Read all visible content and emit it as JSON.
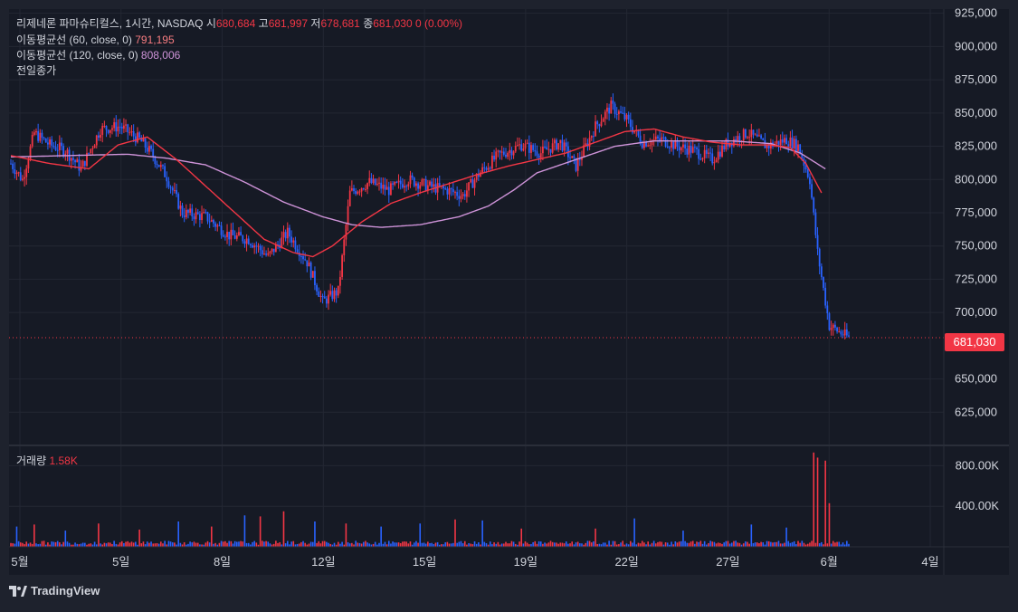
{
  "header": {
    "symbol": "리제네론 파마슈티컬스, 1시간, NASDAQ",
    "open_label": "시",
    "open": "680,684",
    "high_label": "고",
    "high": "681,997",
    "low_label": "저",
    "low": "678,681",
    "close_label": "종",
    "close": "681,030",
    "change": "0 (0.00%)",
    "ma60_label": "이동평균선 (60, close, 0)",
    "ma60_value": "791,195",
    "ma120_label": "이동평균선 (120, close, 0)",
    "ma120_value": "808,006",
    "prev_close_label": "전일종가"
  },
  "volume_panel": {
    "label": "거래량",
    "value": "1.58K"
  },
  "last_price_tag": "681,030",
  "branding": {
    "name": "TradingView"
  },
  "colors": {
    "background": "#1e222d",
    "up": "#f23645",
    "down": "#2962ff",
    "ma60": "#f23645",
    "ma120": "#ce93d8"
  },
  "chart_data": {
    "type": "candlestick",
    "x_tick_labels": [
      "5월",
      "5일",
      "8일",
      "12일",
      "15일",
      "19일",
      "22일",
      "27일",
      "6월",
      "4일"
    ],
    "price_axis_labels": [
      "925,000",
      "900,000",
      "875,000",
      "850,000",
      "825,000",
      "800,000",
      "775,000",
      "750,000",
      "725,000",
      "700,000",
      "650,000",
      "625,000"
    ],
    "volume_axis_labels": [
      "800.00K",
      "400.00K"
    ],
    "ylim": [
      600000,
      935000
    ],
    "volume_ylim": [
      0,
      1000000
    ],
    "last_price": 681030,
    "price_anchors": [
      [
        0,
        812000
      ],
      [
        6,
        800000
      ],
      [
        12,
        835000
      ],
      [
        20,
        826000
      ],
      [
        28,
        822000
      ],
      [
        36,
        808000
      ],
      [
        46,
        838000
      ],
      [
        56,
        840000
      ],
      [
        66,
        830000
      ],
      [
        72,
        820000
      ],
      [
        80,
        802000
      ],
      [
        88,
        775000
      ],
      [
        100,
        772000
      ],
      [
        112,
        758000
      ],
      [
        122,
        755000
      ],
      [
        132,
        742000
      ],
      [
        142,
        760000
      ],
      [
        152,
        738000
      ],
      [
        160,
        708000
      ],
      [
        168,
        716000
      ],
      [
        174,
        790000
      ],
      [
        184,
        798000
      ],
      [
        194,
        792000
      ],
      [
        204,
        800000
      ],
      [
        214,
        795000
      ],
      [
        224,
        792000
      ],
      [
        232,
        788000
      ],
      [
        240,
        804000
      ],
      [
        250,
        818000
      ],
      [
        262,
        826000
      ],
      [
        272,
        820000
      ],
      [
        282,
        828000
      ],
      [
        290,
        810000
      ],
      [
        300,
        840000
      ],
      [
        308,
        855000
      ],
      [
        316,
        845000
      ],
      [
        324,
        828000
      ],
      [
        334,
        830000
      ],
      [
        342,
        825000
      ],
      [
        350,
        822000
      ],
      [
        360,
        815000
      ],
      [
        368,
        828000
      ],
      [
        378,
        835000
      ],
      [
        388,
        825000
      ],
      [
        398,
        830000
      ],
      [
        404,
        825000
      ],
      [
        410,
        800000
      ],
      [
        414,
        745000
      ],
      [
        420,
        690000
      ],
      [
        430,
        681030
      ]
    ],
    "ma60_anchors": [
      [
        0,
        818000
      ],
      [
        20,
        812000
      ],
      [
        40,
        808000
      ],
      [
        55,
        826000
      ],
      [
        70,
        832000
      ],
      [
        85,
        815000
      ],
      [
        100,
        795000
      ],
      [
        115,
        775000
      ],
      [
        130,
        755000
      ],
      [
        145,
        745000
      ],
      [
        155,
        742000
      ],
      [
        165,
        750000
      ],
      [
        180,
        768000
      ],
      [
        195,
        782000
      ],
      [
        210,
        790000
      ],
      [
        225,
        797000
      ],
      [
        240,
        804000
      ],
      [
        255,
        810000
      ],
      [
        270,
        815000
      ],
      [
        285,
        820000
      ],
      [
        300,
        828000
      ],
      [
        315,
        836000
      ],
      [
        330,
        838000
      ],
      [
        345,
        832000
      ],
      [
        360,
        828000
      ],
      [
        375,
        826000
      ],
      [
        390,
        826000
      ],
      [
        400,
        824000
      ],
      [
        408,
        812000
      ],
      [
        416,
        790000
      ]
    ],
    "ma120_anchors": [
      [
        0,
        817000
      ],
      [
        30,
        818000
      ],
      [
        60,
        819000
      ],
      [
        80,
        816000
      ],
      [
        100,
        811000
      ],
      [
        120,
        798000
      ],
      [
        140,
        783000
      ],
      [
        160,
        772000
      ],
      [
        175,
        766000
      ],
      [
        190,
        764000
      ],
      [
        210,
        766000
      ],
      [
        230,
        772000
      ],
      [
        245,
        780000
      ],
      [
        258,
        792000
      ],
      [
        270,
        805000
      ],
      [
        290,
        815000
      ],
      [
        310,
        825000
      ],
      [
        330,
        829000
      ],
      [
        350,
        829000
      ],
      [
        370,
        829000
      ],
      [
        390,
        827000
      ],
      [
        405,
        820000
      ],
      [
        418,
        808000
      ]
    ],
    "volume_spikes": [
      [
        3,
        200000
      ],
      [
        12,
        220000
      ],
      [
        28,
        160000
      ],
      [
        45,
        230000
      ],
      [
        66,
        170000
      ],
      [
        86,
        250000
      ],
      [
        103,
        200000
      ],
      [
        120,
        310000
      ],
      [
        128,
        300000
      ],
      [
        140,
        350000
      ],
      [
        156,
        250000
      ],
      [
        172,
        230000
      ],
      [
        190,
        200000
      ],
      [
        210,
        230000
      ],
      [
        228,
        270000
      ],
      [
        242,
        260000
      ],
      [
        262,
        180000
      ],
      [
        300,
        180000
      ],
      [
        320,
        280000
      ],
      [
        345,
        160000
      ],
      [
        380,
        220000
      ],
      [
        398,
        190000
      ],
      [
        412,
        930000
      ],
      [
        414,
        880000
      ],
      [
        418,
        850000
      ],
      [
        420,
        430000
      ]
    ]
  }
}
